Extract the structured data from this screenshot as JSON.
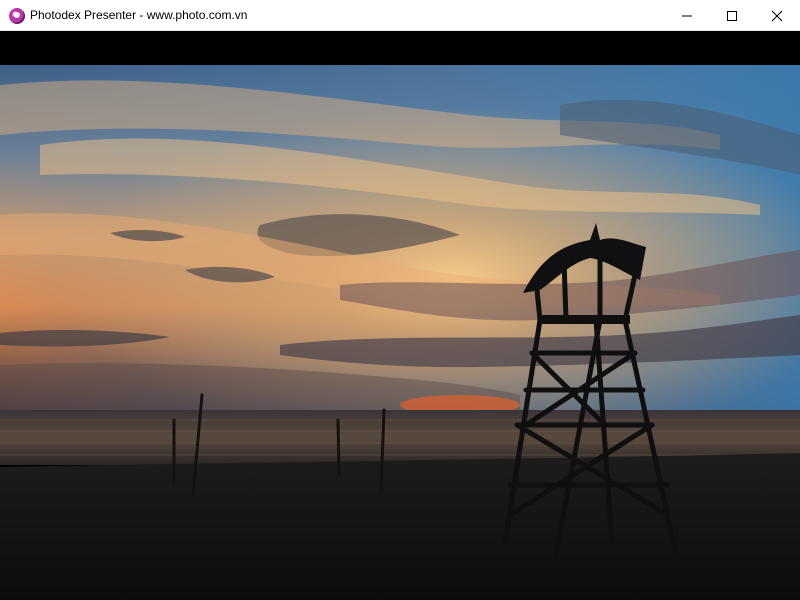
{
  "window": {
    "title": "Photodex Presenter - www.photo.com.vn",
    "app_icon": "photodex-icon",
    "controls": {
      "minimize_icon": "minimize-icon",
      "maximize_icon": "maximize-icon",
      "close_icon": "close-icon"
    }
  },
  "photo": {
    "subject": "beach sunset with lifeguard tower silhouette",
    "colors": {
      "sky_top": "#3a6e9c",
      "sky_glow": "#f3c27a",
      "sun": "#e05a2a",
      "sea": "#2a2a2e",
      "sand": "#121212"
    }
  }
}
